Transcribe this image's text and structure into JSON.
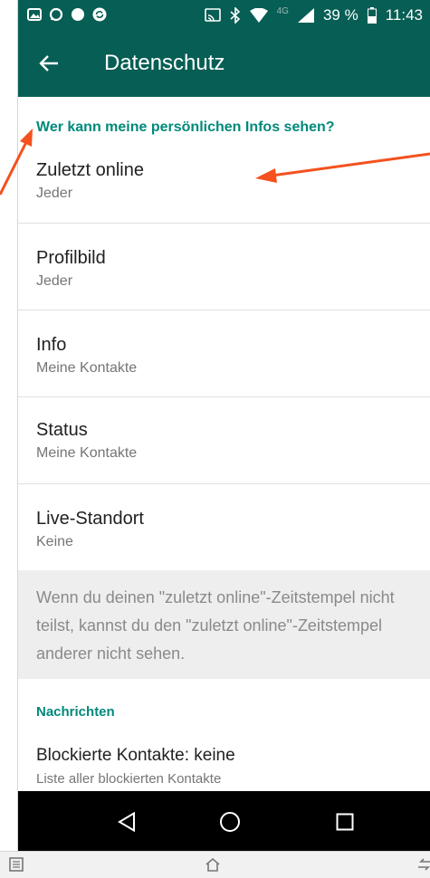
{
  "status_bar": {
    "network": "4G",
    "battery": "39 %",
    "time": "11:43",
    "icons": [
      "gallery-icon",
      "whatsapp-icon",
      "circle-icon",
      "sync-icon",
      "cast-icon",
      "bluetooth-icon",
      "wifi-icon",
      "signal-icon",
      "battery-icon"
    ]
  },
  "app_bar": {
    "title": "Datenschutz",
    "back_icon": "arrow-left-icon"
  },
  "sections": {
    "personal_info_header": "Wer kann meine persönlichen Infos sehen?",
    "messages_header": "Nachrichten"
  },
  "rows": [
    {
      "title": "Zuletzt online",
      "subtitle": "Jeder"
    },
    {
      "title": "Profilbild",
      "subtitle": "Jeder"
    },
    {
      "title": "Info",
      "subtitle": "Meine Kontakte"
    },
    {
      "title": "Status",
      "subtitle": "Meine Kontakte"
    },
    {
      "title": "Live-Standort",
      "subtitle": "Keine"
    }
  ],
  "info_note": "Wenn du deinen \"zuletzt online\"-Zeitstempel nicht teilst, kannst du den \"zuletzt online\"-Zeitstempel anderer nicht sehen.",
  "blocked": {
    "title": "Blockierte Kontakte: keine",
    "subtitle": "Liste aller blockierten Kontakte"
  },
  "nav_bar": {
    "back": "triangle-back-icon",
    "home": "circle-home-icon",
    "recents": "square-recents-icon"
  },
  "colors": {
    "header_green": "#075e54",
    "accent_teal": "#00897b",
    "annotation_arrow": "#f4511e"
  }
}
